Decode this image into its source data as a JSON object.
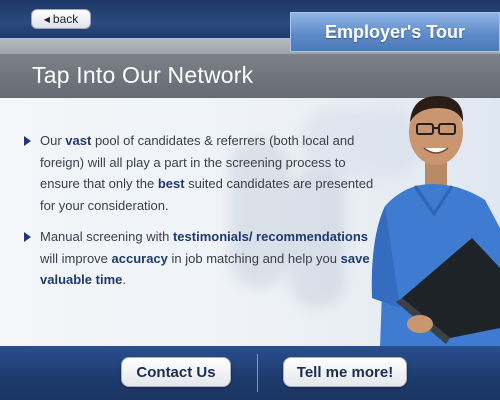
{
  "header": {
    "back_label": "back",
    "tour_label": "Employer's Tour"
  },
  "page": {
    "title": "Tap Into Our Network"
  },
  "bullets": [
    {
      "parts": [
        "Our ",
        "vast",
        " pool of candidates & referrers (both local and foreign) will all play a part in the screening process to ensure that only the ",
        "best",
        " suited candidates are presented for your consideration."
      ]
    },
    {
      "parts": [
        "Manual screening with ",
        "testimonials/ recommendations",
        " will improve ",
        "accuracy",
        " in job matching and help you ",
        "save valuable time",
        "."
      ]
    }
  ],
  "footer": {
    "contact_label": "Contact Us",
    "more_label": "Tell me more!"
  },
  "colors": {
    "navy": "#1e3a6e",
    "tab_blue": "#5f8cc9",
    "title_gray": "#6f747c"
  }
}
